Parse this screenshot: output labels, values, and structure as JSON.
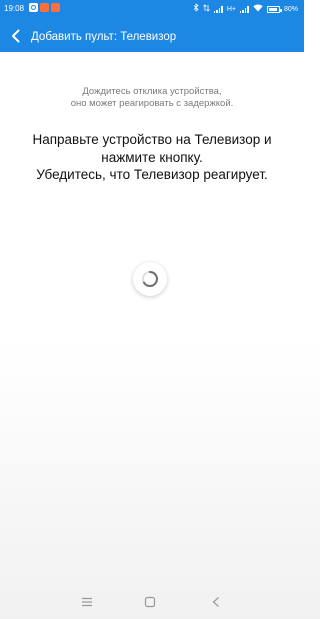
{
  "status_bar": {
    "time": "19:08",
    "network": "H+",
    "battery": "80%",
    "notification_icons": [
      "app-notification-icon",
      "app-notification-icon-orange",
      "app-notification-icon-orange"
    ],
    "system_icons": [
      "bluetooth-icon",
      "data-transfer-icon",
      "signal-icon",
      "wifi-icon",
      "battery-icon"
    ]
  },
  "app_bar": {
    "title": "Добавить пульт: Телевизор",
    "back_icon": "chevron-left-icon"
  },
  "main": {
    "hint_line1": "Дождитесь отклика устройства,",
    "hint_line2": "оно может реагировать с задержкой.",
    "instruction_line1": "Направьте устройство на Телевизор и",
    "instruction_line2": "нажмите кнопку.",
    "instruction_line3": "Убедитесь, что Телевизор реагирует.",
    "loading_icon": "loading-spinner-icon"
  },
  "nav_bar": {
    "icons": [
      "menu-icon",
      "home-icon",
      "back-triangle-icon"
    ]
  },
  "colors": {
    "accent": "#1d87e4",
    "text_primary": "#111111",
    "text_secondary": "#7a7a7a"
  }
}
